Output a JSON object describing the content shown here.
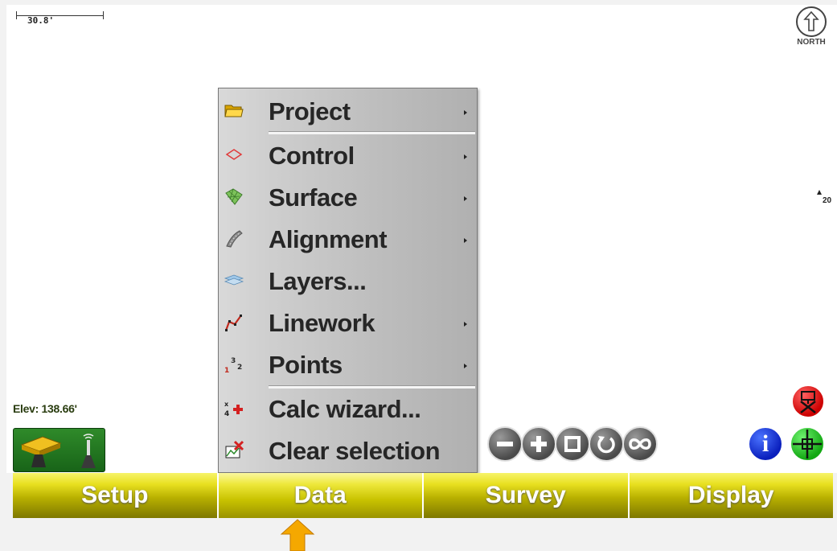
{
  "map": {
    "scale_label": "30.8'",
    "north_label": "NORTH",
    "point_label": "20",
    "elevation_text": "Elev: 138.66'"
  },
  "menu": {
    "items": [
      {
        "label": "Project",
        "icon": "folder-icon",
        "submenu": true
      },
      {
        "label": "Control",
        "icon": "control-diamond-icon",
        "submenu": true
      },
      {
        "label": "Surface",
        "icon": "surface-mesh-icon",
        "submenu": true
      },
      {
        "label": "Alignment",
        "icon": "alignment-icon",
        "submenu": true
      },
      {
        "label": "Layers...",
        "icon": "layers-icon",
        "submenu": false
      },
      {
        "label": "Linework",
        "icon": "linework-icon",
        "submenu": true
      },
      {
        "label": "Points",
        "icon": "points-icon",
        "submenu": true
      },
      {
        "label": "Calc wizard...",
        "icon": "calc-wizard-icon",
        "submenu": false
      },
      {
        "label": "Clear selection",
        "icon": "clear-selection-icon",
        "submenu": false
      }
    ]
  },
  "toolbar": {
    "buttons": [
      "zoom-out-icon",
      "zoom-in-icon",
      "zoom-window-icon",
      "rotate-icon",
      "zoom-extents-icon"
    ]
  },
  "tabs": [
    {
      "label": "Setup",
      "active": false
    },
    {
      "label": "Data",
      "active": true
    },
    {
      "label": "Survey",
      "active": false
    },
    {
      "label": "Display",
      "active": false
    }
  ],
  "colors": {
    "tab_yellow": "#e8e020",
    "gps_green": "#2f8a2a",
    "pointer_orange": "#f5a800"
  }
}
